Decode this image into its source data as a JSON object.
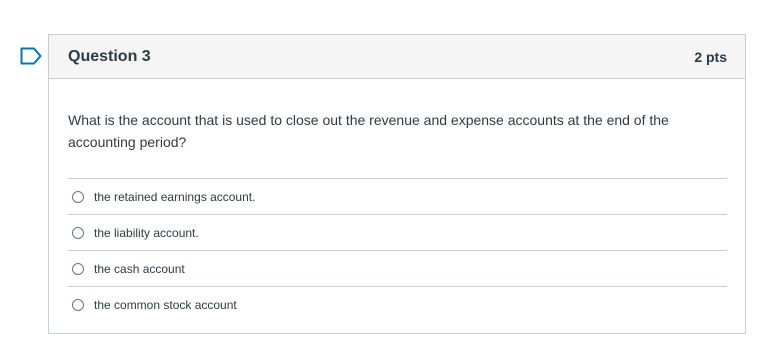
{
  "question": {
    "title": "Question 3",
    "points": "2 pts",
    "text": "What is the account that is used to close out the revenue and expense accounts at the end of the accounting period?",
    "answers": [
      {
        "label": "the retained earnings account."
      },
      {
        "label": "the liability account."
      },
      {
        "label": "the cash account"
      },
      {
        "label": "the common stock account"
      }
    ]
  },
  "colors": {
    "flag": "#0374b5",
    "border": "#c7cdd1",
    "header_bg": "#f5f5f5",
    "text": "#2d3b45"
  },
  "icons": {
    "flag": "bookmark-flag-icon",
    "option": "radio-button-icon"
  }
}
